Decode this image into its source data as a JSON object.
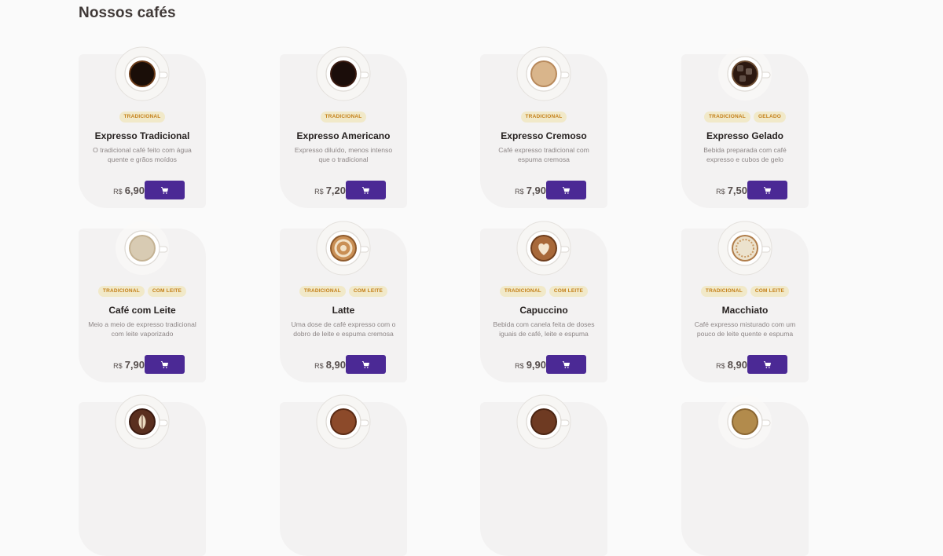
{
  "page_title": "Nossos cafés",
  "currency": "R$",
  "cart_icon": "shopping-cart-icon",
  "colors": {
    "background": "#fafafa",
    "card": "#f3f2f2",
    "tag_bg": "#f1e9c9",
    "tag_text": "#c47f17",
    "button": "#4b2995",
    "title": "#403937"
  },
  "products": [
    {
      "name": "Expresso Tradicional",
      "description": "O tradicional café feito com água quente e grãos moídos",
      "price": "6,90",
      "tags": [
        "TRADICIONAL"
      ],
      "icon": "espresso-cup-icon"
    },
    {
      "name": "Expresso Americano",
      "description": "Expresso diluído, menos intenso que o tradicional",
      "price": "7,20",
      "tags": [
        "TRADICIONAL"
      ],
      "icon": "americano-cup-icon"
    },
    {
      "name": "Expresso Cremoso",
      "description": "Café expresso tradicional com espuma cremosa",
      "price": "7,90",
      "tags": [
        "TRADICIONAL"
      ],
      "icon": "creamy-espresso-cup-icon"
    },
    {
      "name": "Expresso Gelado",
      "description": "Bebida preparada com café expresso e cubos de gelo",
      "price": "7,50",
      "tags": [
        "TRADICIONAL",
        "GELADO"
      ],
      "icon": "iced-espresso-cup-icon"
    },
    {
      "name": "Café com Leite",
      "description": "Meio a meio de expresso tradicional com leite vaporizado",
      "price": "7,90",
      "tags": [
        "TRADICIONAL",
        "COM LEITE"
      ],
      "icon": "coffee-with-milk-cup-icon"
    },
    {
      "name": "Latte",
      "description": "Uma dose de café expresso com o dobro de leite e espuma cremosa",
      "price": "8,90",
      "tags": [
        "TRADICIONAL",
        "COM LEITE"
      ],
      "icon": "latte-cup-icon"
    },
    {
      "name": "Capuccino",
      "description": "Bebida com canela feita de doses iguais de café, leite e espuma",
      "price": "9,90",
      "tags": [
        "TRADICIONAL",
        "COM LEITE"
      ],
      "icon": "cappuccino-cup-icon"
    },
    {
      "name": "Macchiato",
      "description": "Café expresso misturado com um pouco de leite quente e espuma",
      "price": "8,90",
      "tags": [
        "TRADICIONAL",
        "COM LEITE"
      ],
      "icon": "macchiato-cup-icon"
    },
    {
      "name": "",
      "description": "",
      "price": "",
      "tags": [],
      "icon": "mocaccino-cup-icon"
    },
    {
      "name": "",
      "description": "",
      "price": "",
      "tags": [],
      "icon": "hot-chocolate-cup-icon"
    },
    {
      "name": "",
      "description": "",
      "price": "",
      "tags": [],
      "icon": "cubano-cup-icon"
    },
    {
      "name": "",
      "description": "",
      "price": "",
      "tags": [],
      "icon": "havaiano-cup-icon"
    }
  ]
}
